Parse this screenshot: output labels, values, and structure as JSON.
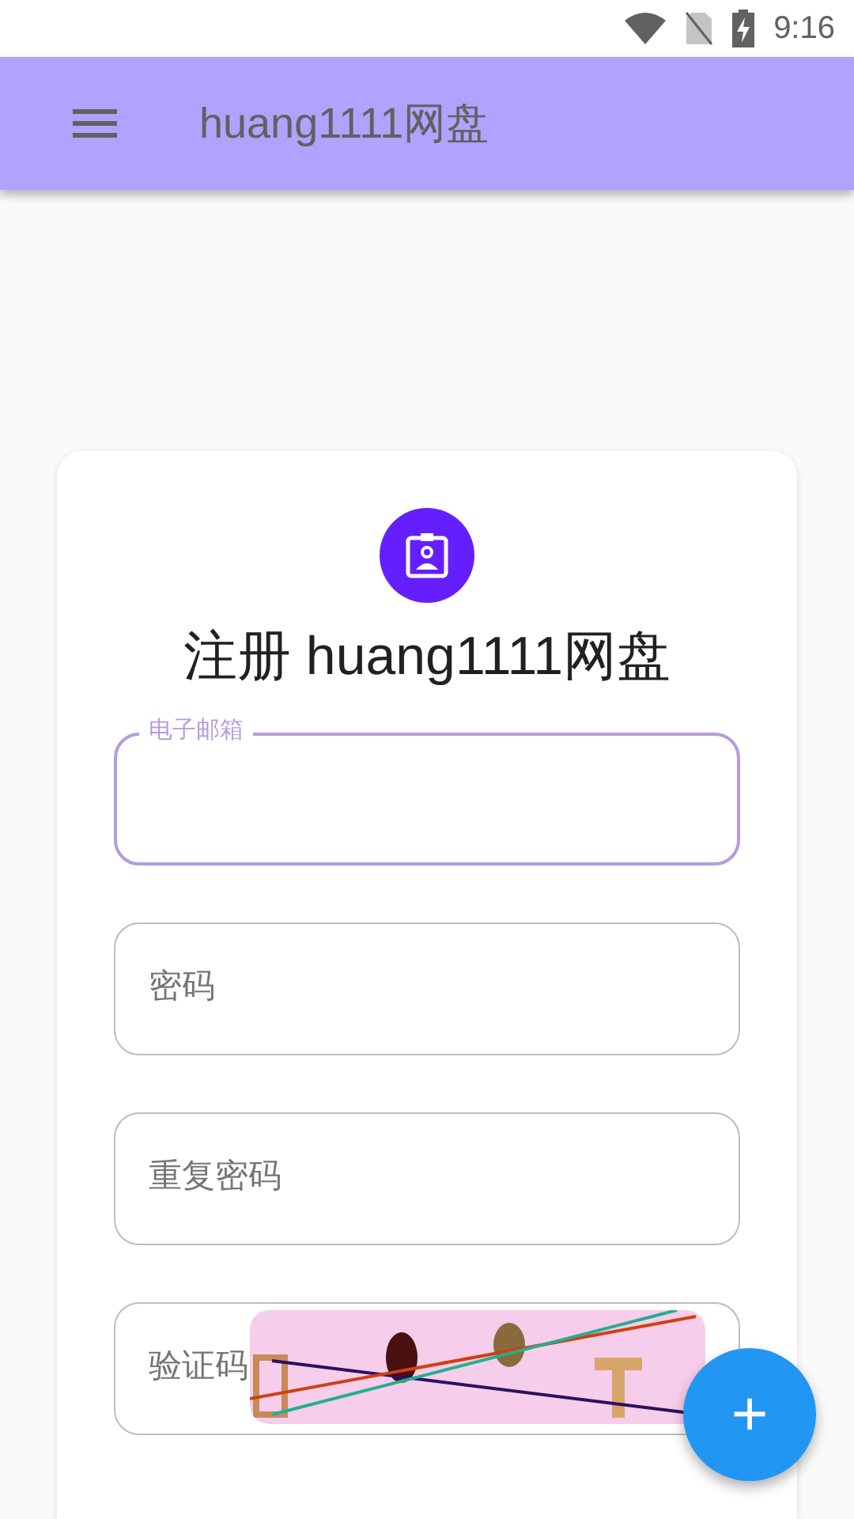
{
  "status_bar": {
    "time": "9:16"
  },
  "app_bar": {
    "title": "huang1111网盘"
  },
  "form": {
    "title": "注册 huang1111网盘",
    "fields": [
      {
        "label": "电子邮箱",
        "focused": true
      },
      {
        "label": "密码",
        "focused": false
      },
      {
        "label": "重复密码",
        "focused": false
      },
      {
        "label": "验证码",
        "focused": false
      }
    ]
  },
  "fab": {
    "label": "+"
  }
}
